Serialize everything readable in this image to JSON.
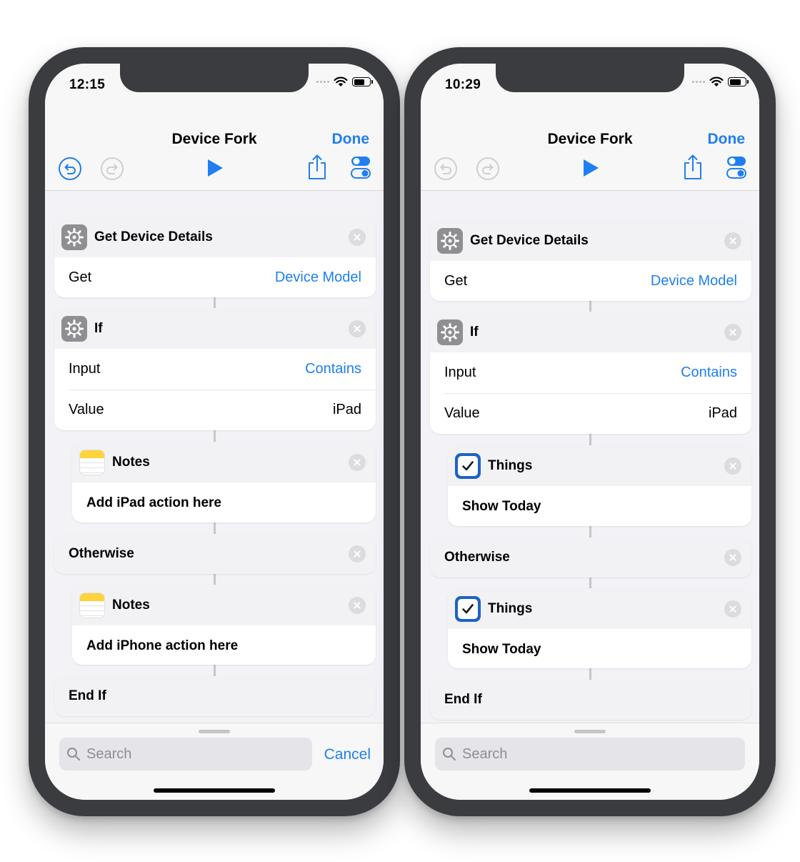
{
  "left": {
    "time": "12:15",
    "title": "Device Fork",
    "done": "Done",
    "get_block": {
      "title": "Get Device Details",
      "row_label": "Get",
      "row_value": "Device Model"
    },
    "if_block": {
      "title": "If",
      "input_label": "Input",
      "input_value": "Contains",
      "value_label": "Value",
      "value_value": "iPad"
    },
    "ipad_action": {
      "title": "Notes",
      "body": "Add iPad action here"
    },
    "otherwise": "Otherwise",
    "iphone_action": {
      "title": "Notes",
      "body": "Add iPhone action here"
    },
    "end_if": "End If",
    "search_placeholder": "Search",
    "cancel": "Cancel"
  },
  "right": {
    "time": "10:29",
    "title": "Device Fork",
    "done": "Done",
    "get_block": {
      "title": "Get Device Details",
      "row_label": "Get",
      "row_value": "Device Model"
    },
    "if_block": {
      "title": "If",
      "input_label": "Input",
      "input_value": "Contains",
      "value_label": "Value",
      "value_value": "iPad"
    },
    "ipad_action": {
      "title": "Things",
      "body": "Show Today"
    },
    "otherwise": "Otherwise",
    "iphone_action": {
      "title": "Things",
      "body": "Show Today"
    },
    "end_if": "End If",
    "search_placeholder": "Search"
  },
  "colors": {
    "accent": "#1f7ff0",
    "bezel": "#3a3c40",
    "things_blue": "#1e62c6",
    "notes_yellow": "#fed33b"
  },
  "icons": [
    "undo-icon",
    "redo-icon",
    "play-icon",
    "share-icon",
    "settings-toggle-icon",
    "gear-icon",
    "notes-app-icon",
    "things-app-icon",
    "search-icon",
    "wifi-icon",
    "battery-icon"
  ]
}
